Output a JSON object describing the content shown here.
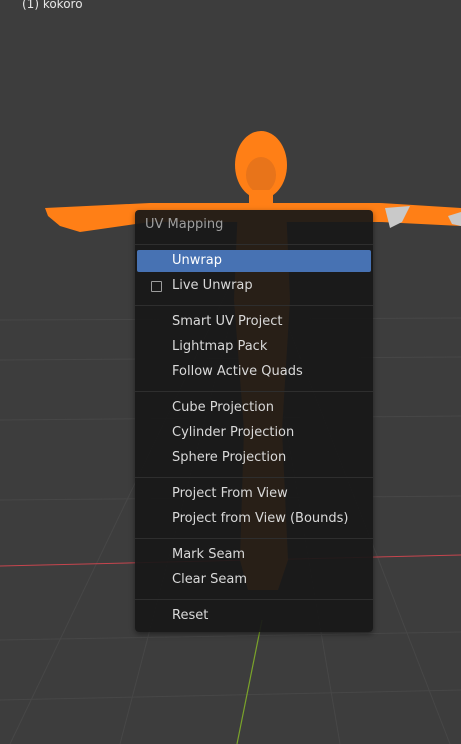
{
  "viewport": {
    "object_label": "(1) kokoro",
    "colors": {
      "background": "#3d3d3d",
      "selection_orange": "#ff7f16",
      "axis_x": "#c6454e",
      "axis_y": "#7aa32a"
    }
  },
  "menu": {
    "title": "UV Mapping",
    "active_color": "#4772b3",
    "items": [
      {
        "label": "Unwrap",
        "active": true
      },
      {
        "label": "Live Unwrap",
        "checkbox": true,
        "checked": false
      },
      {
        "label": "Smart UV Project"
      },
      {
        "label": "Lightmap Pack"
      },
      {
        "label": "Follow Active Quads"
      },
      {
        "label": "Cube Projection"
      },
      {
        "label": "Cylinder Projection"
      },
      {
        "label": "Sphere Projection"
      },
      {
        "label": "Project From View"
      },
      {
        "label": "Project from View (Bounds)"
      },
      {
        "label": "Mark Seam"
      },
      {
        "label": "Clear Seam"
      },
      {
        "label": "Reset"
      }
    ]
  }
}
